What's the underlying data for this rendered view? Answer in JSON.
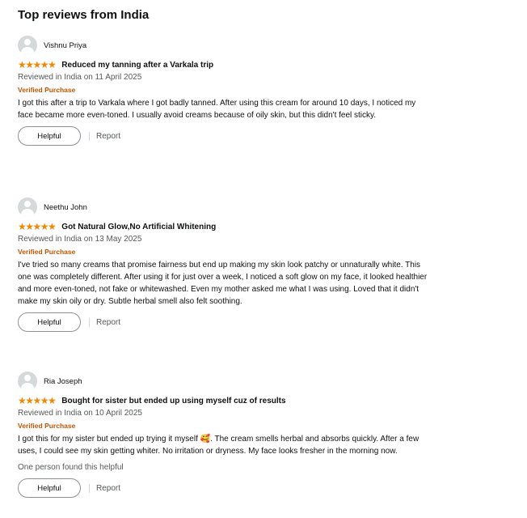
{
  "section_title": "Top reviews from India",
  "colors": {
    "star": "#f08804",
    "verified": "#c45500",
    "muted": "#565959"
  },
  "reviews": [
    {
      "author": "Vishnu Priya",
      "rating": 5,
      "stars": "★★★★★",
      "headline": "Reduced my tanning after a Varkala trip",
      "date": "Reviewed in India on 11 April 2025",
      "verified": "Verified Purchase",
      "body": "I got this after a trip to Varkala where I got badly tanned. After using this cream for around 10 days, I noticed my face became more even-toned. I usually avoid creams because of oily skin, but this didn't feel sticky.",
      "helpful_label": "Helpful",
      "report_label": "Report"
    },
    {
      "author": "Neethu John",
      "rating": 5,
      "stars": "★★★★★",
      "headline": "Got Natural Glow,No Artificial Whitening",
      "date": "Reviewed in India on 13 May 2025",
      "verified": "Verified Purchase",
      "body": "I've tried so many creams that promise fairness but end up making my skin look patchy or unnaturally white. This one was completely different. After using it for just over a week, I noticed a soft glow on my face, it looked healthier and more even-toned, not fake or whitewashed. Even my mother asked me what I was using. Loved that it didn't make my skin oily or dry. Subtle herbal smell also felt soothing.",
      "helpful_label": "Helpful",
      "report_label": "Report"
    },
    {
      "author": "Ria Joseph",
      "rating": 5,
      "stars": "★★★★★",
      "headline": "Bought for sister but ended up using myself cuz of results",
      "date": "Reviewed in India on 10 April 2025",
      "verified": "Verified Purchase",
      "body": "I got this for my sister but ended up trying it myself 🥰. The cream smells herbal and absorbs quickly. After a few uses, I could see my skin getting whiter. No irritation or dryness. My face looks fresher in the morning now.",
      "found_helpful": "One person found this helpful",
      "helpful_label": "Helpful",
      "report_label": "Report"
    }
  ]
}
